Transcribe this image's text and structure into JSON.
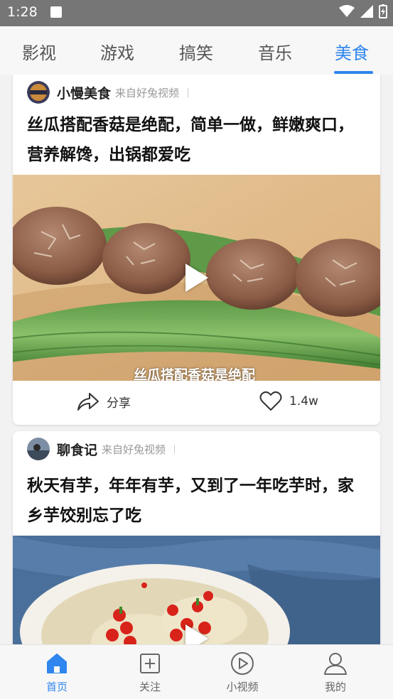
{
  "status_bar": {
    "time": "1:28"
  },
  "top_tabs": [
    {
      "label": "影视"
    },
    {
      "label": "游戏"
    },
    {
      "label": "搞笑"
    },
    {
      "label": "音乐"
    },
    {
      "label": "美食",
      "active": true
    }
  ],
  "cards": [
    {
      "author": "小慢美食",
      "source": "来自好兔视频",
      "title": "丝瓜搭配香菇是绝配，简单一做，鲜嫩爽口，营养解馋，出锅都爱吃",
      "video_caption": "丝瓜搭配香菇是绝配",
      "share_label": "分享",
      "likes": "1.4w"
    },
    {
      "author": "聊食记",
      "source": "来自好兔视频",
      "title": "秋天有芋，年年有芋，又到了一年吃芋时，家乡芋饺别忘了吃"
    }
  ],
  "bottom_nav": [
    {
      "label": "首页",
      "icon": "home-icon",
      "active": true
    },
    {
      "label": "关注",
      "icon": "plus-square-icon"
    },
    {
      "label": "小视频",
      "icon": "play-circle-icon"
    },
    {
      "label": "我的",
      "icon": "user-icon"
    }
  ],
  "colors": {
    "accent": "#2f86ee",
    "status_bar": "#767676"
  }
}
